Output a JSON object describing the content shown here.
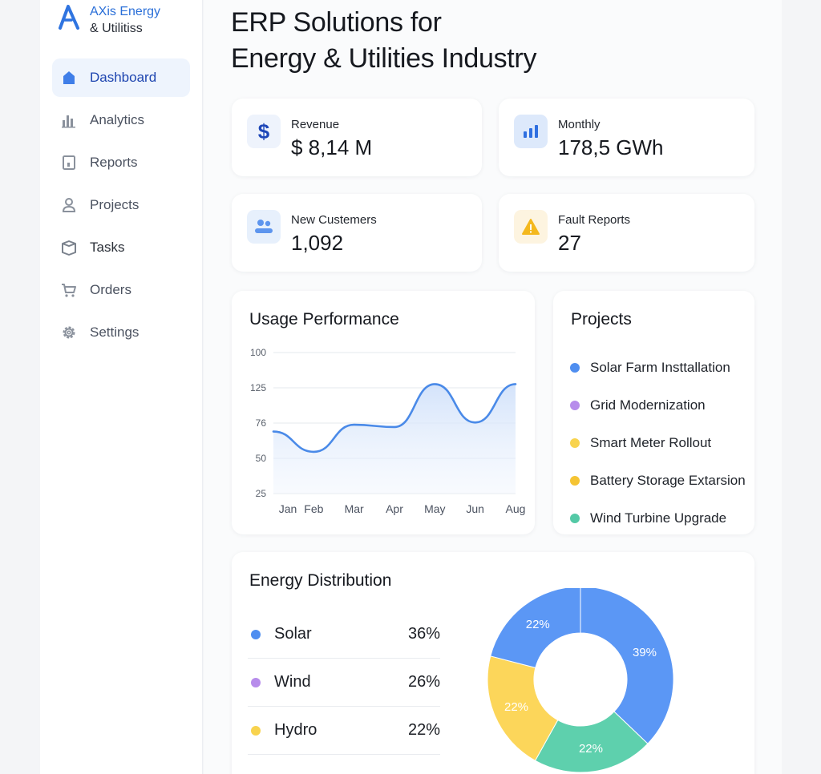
{
  "brand": {
    "line1": "AXis Energy",
    "line2": "& Utilitiss"
  },
  "sidebar": {
    "items": [
      {
        "label": "Dashboard",
        "icon": "home-icon"
      },
      {
        "label": "Analytics",
        "icon": "bar-chart-icon"
      },
      {
        "label": "Reports",
        "icon": "document-icon"
      },
      {
        "label": "Projects",
        "icon": "user-icon"
      },
      {
        "label": "Tasks",
        "icon": "box-icon"
      },
      {
        "label": "Orders",
        "icon": "cart-icon"
      },
      {
        "label": "Settings",
        "icon": "gear-icon"
      }
    ]
  },
  "page": {
    "title_line1": "ERP Solutions for",
    "title_line2": "Energy & Utilities Industry"
  },
  "kpis": [
    {
      "label": "Revenue",
      "value": "$ 8,14 M",
      "icon": "dollar-icon"
    },
    {
      "label": "Monthly",
      "value": "178,5 GWh",
      "icon": "bar-chart-icon"
    },
    {
      "label": "New Custemers",
      "value": "1,092",
      "icon": "users-icon"
    },
    {
      "label": "Fault Reports",
      "value": "27",
      "icon": "warning-icon"
    }
  ],
  "usage": {
    "title": "Usage Performance",
    "chart_data": {
      "type": "area",
      "categories": [
        "Jan",
        "Feb",
        "Mar",
        "Apr",
        "May",
        "Jun",
        "Aug"
      ],
      "y_ticks": [
        "100",
        "125",
        "76",
        "50",
        "25"
      ],
      "values": [
        80,
        62,
        86,
        84,
        122,
        88,
        122
      ],
      "ylim": [
        25,
        150
      ],
      "grid": true,
      "color": "#4a8ae8"
    }
  },
  "projects": {
    "title": "Projects",
    "items": [
      {
        "label": "Solar Farm Insttallation",
        "color": "#4f8ef0"
      },
      {
        "label": "Grid Modernization",
        "color": "#b78ceb"
      },
      {
        "label": "Smart Meter Rollout",
        "color": "#f8d34e"
      },
      {
        "label": "Battery Storage Extarsion",
        "color": "#f5c433"
      },
      {
        "label": "Wind Turbine Upgrade",
        "color": "#54c9a6"
      }
    ]
  },
  "distribution": {
    "title": "Energy Distribution",
    "rows": [
      {
        "name": "Solar",
        "pct": "36%",
        "color": "#4f8ef0"
      },
      {
        "name": "Wind",
        "pct": "26%",
        "color": "#b78ceb"
      },
      {
        "name": "Hydro",
        "pct": "22%",
        "color": "#f8d34e"
      }
    ],
    "chart_data": {
      "type": "pie",
      "slices": [
        {
          "label": "39%",
          "value": 39,
          "color": "#5b97f5"
        },
        {
          "label": "22%",
          "value": 22,
          "color": "#5ed0ad"
        },
        {
          "label": "22%",
          "value": 22,
          "color": "#fcd65a"
        },
        {
          "label": "22%",
          "value": 22,
          "color": "#5b97f5"
        }
      ]
    }
  }
}
